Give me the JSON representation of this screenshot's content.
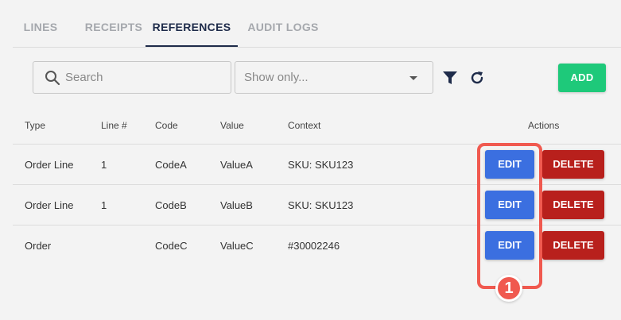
{
  "tabs": [
    {
      "label": "LINES",
      "active": false
    },
    {
      "label": "RECEIPTS",
      "active": false
    },
    {
      "label": "REFERENCES",
      "active": true
    },
    {
      "label": "AUDIT LOGS",
      "active": false
    }
  ],
  "toolbar": {
    "search_placeholder": "Search",
    "filter_placeholder": "Show only...",
    "add_label": "ADD",
    "icons": [
      "search-icon",
      "filter-icon",
      "refresh-icon",
      "chevron-down-icon"
    ]
  },
  "table": {
    "columns": [
      "Type",
      "Line #",
      "Code",
      "Value",
      "Context",
      "Actions"
    ],
    "rows": [
      {
        "type": "Order Line",
        "line": "1",
        "code": "CodeA",
        "value": "ValueA",
        "context": "SKU: SKU123"
      },
      {
        "type": "Order Line",
        "line": "1",
        "code": "CodeB",
        "value": "ValueB",
        "context": "SKU: SKU123"
      },
      {
        "type": "Order",
        "line": "",
        "code": "CodeC",
        "value": "ValueC",
        "context": "#30002246"
      }
    ],
    "edit_label": "EDIT",
    "delete_label": "DELETE"
  },
  "annotation": {
    "badge": "1"
  },
  "colors": {
    "active_tab": "#1e2b4a",
    "add_button": "#1ec97a",
    "edit_button": "#3b6fe0",
    "delete_button": "#b8201c",
    "highlight": "#f0594f"
  }
}
